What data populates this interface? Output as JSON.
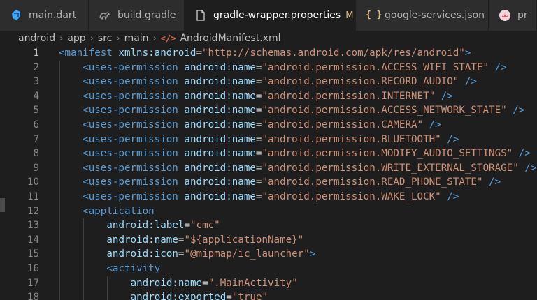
{
  "tabs": [
    {
      "label": "main.dart",
      "icon": "dart-icon",
      "active": false
    },
    {
      "label": "build.gradle",
      "icon": "gradle-icon",
      "active": false
    },
    {
      "label": "gradle-wrapper.properties",
      "icon": "file-icon",
      "active": true,
      "modified": "M"
    },
    {
      "label": "google-services.json",
      "icon": "json-icon",
      "active": false
    },
    {
      "label": "pr",
      "icon": "android-icon",
      "active": false
    }
  ],
  "breadcrumb": {
    "items": [
      "android",
      "app",
      "src",
      "main"
    ],
    "file_icon": "</>",
    "file": "AndroidManifest.xml"
  },
  "editor": {
    "current_line": 1,
    "lines": [
      {
        "n": "1",
        "tokens": [
          [
            "tag",
            "<manifest"
          ],
          [
            "eq",
            " "
          ],
          [
            "attr",
            "xmlns:android"
          ],
          [
            "eq",
            "="
          ],
          [
            "str",
            "\"http://schemas.android.com/apk/res/android\""
          ],
          [
            "tag",
            ">"
          ]
        ]
      },
      {
        "n": "2",
        "tokens": [
          [
            "tag",
            "<uses-permission"
          ],
          [
            "eq",
            " "
          ],
          [
            "attr",
            "android:name"
          ],
          [
            "eq",
            "="
          ],
          [
            "str",
            "\"android.permission.ACCESS_WIFI_STATE\""
          ],
          [
            "eq",
            " "
          ],
          [
            "tag",
            "/>"
          ]
        ]
      },
      {
        "n": "3",
        "tokens": [
          [
            "tag",
            "<uses-permission"
          ],
          [
            "eq",
            " "
          ],
          [
            "attr",
            "android:name"
          ],
          [
            "eq",
            "="
          ],
          [
            "str",
            "\"android.permission.RECORD_AUDIO\""
          ],
          [
            "eq",
            " "
          ],
          [
            "tag",
            "/>"
          ]
        ]
      },
      {
        "n": "4",
        "tokens": [
          [
            "tag",
            "<uses-permission"
          ],
          [
            "eq",
            " "
          ],
          [
            "attr",
            "android:name"
          ],
          [
            "eq",
            "="
          ],
          [
            "str",
            "\"android.permission.INTERNET\""
          ],
          [
            "eq",
            " "
          ],
          [
            "tag",
            "/>"
          ]
        ]
      },
      {
        "n": "5",
        "tokens": [
          [
            "tag",
            "<uses-permission"
          ],
          [
            "eq",
            " "
          ],
          [
            "attr",
            "android:name"
          ],
          [
            "eq",
            "="
          ],
          [
            "str",
            "\"android.permission.ACCESS_NETWORK_STATE\""
          ],
          [
            "eq",
            " "
          ],
          [
            "tag",
            "/>"
          ]
        ]
      },
      {
        "n": "6",
        "tokens": [
          [
            "tag",
            "<uses-permission"
          ],
          [
            "eq",
            " "
          ],
          [
            "attr",
            "android:name"
          ],
          [
            "eq",
            "="
          ],
          [
            "str",
            "\"android.permission.CAMERA\""
          ],
          [
            "eq",
            " "
          ],
          [
            "tag",
            "/>"
          ]
        ]
      },
      {
        "n": "7",
        "tokens": [
          [
            "tag",
            "<uses-permission"
          ],
          [
            "eq",
            " "
          ],
          [
            "attr",
            "android:name"
          ],
          [
            "eq",
            "="
          ],
          [
            "str",
            "\"android.permission.BLUETOOTH\""
          ],
          [
            "eq",
            " "
          ],
          [
            "tag",
            "/>"
          ]
        ]
      },
      {
        "n": "8",
        "tokens": [
          [
            "tag",
            "<uses-permission"
          ],
          [
            "eq",
            " "
          ],
          [
            "attr",
            "android:name"
          ],
          [
            "eq",
            "="
          ],
          [
            "str",
            "\"android.permission.MODIFY_AUDIO_SETTINGS\""
          ],
          [
            "eq",
            " "
          ],
          [
            "tag",
            "/>"
          ]
        ]
      },
      {
        "n": "9",
        "tokens": [
          [
            "tag",
            "<uses-permission"
          ],
          [
            "eq",
            " "
          ],
          [
            "attr",
            "android:name"
          ],
          [
            "eq",
            "="
          ],
          [
            "str",
            "\"android.permission.WRITE_EXTERNAL_STORAGE\""
          ],
          [
            "eq",
            " "
          ],
          [
            "tag",
            "/>"
          ]
        ]
      },
      {
        "n": "10",
        "tokens": [
          [
            "tag",
            "<uses-permission"
          ],
          [
            "eq",
            " "
          ],
          [
            "attr",
            "android:name"
          ],
          [
            "eq",
            "="
          ],
          [
            "str",
            "\"android.permission.READ_PHONE_STATE\""
          ],
          [
            "eq",
            " "
          ],
          [
            "tag",
            "/>"
          ]
        ]
      },
      {
        "n": "11",
        "tokens": [
          [
            "tag",
            "<uses-permission"
          ],
          [
            "eq",
            " "
          ],
          [
            "attr",
            "android:name"
          ],
          [
            "eq",
            "="
          ],
          [
            "str",
            "\"android.permission.WAKE_LOCK\""
          ],
          [
            "eq",
            " "
          ],
          [
            "tag",
            "/>"
          ]
        ]
      },
      {
        "n": "12",
        "tokens": [
          [
            "tag",
            "<application"
          ]
        ]
      },
      {
        "n": "13",
        "tokens": [
          [
            "attr",
            "android:label"
          ],
          [
            "eq",
            "="
          ],
          [
            "str",
            "\"cmc\""
          ]
        ]
      },
      {
        "n": "14",
        "tokens": [
          [
            "attr",
            "android:name"
          ],
          [
            "eq",
            "="
          ],
          [
            "str",
            "\"${applicationName}\""
          ]
        ]
      },
      {
        "n": "15",
        "tokens": [
          [
            "attr",
            "android:icon"
          ],
          [
            "eq",
            "="
          ],
          [
            "str",
            "\"@mipmap/ic_launcher\""
          ],
          [
            "tag",
            ">"
          ]
        ]
      },
      {
        "n": "16",
        "tokens": [
          [
            "tag",
            "<activity"
          ]
        ]
      },
      {
        "n": "17",
        "tokens": [
          [
            "attr",
            "android:name"
          ],
          [
            "eq",
            "="
          ],
          [
            "str",
            "\".MainActivity\""
          ]
        ]
      },
      {
        "n": "18",
        "tokens": [
          [
            "attr",
            "android:exported"
          ],
          [
            "eq",
            "="
          ],
          [
            "str",
            "\"true\""
          ]
        ]
      }
    ]
  }
}
